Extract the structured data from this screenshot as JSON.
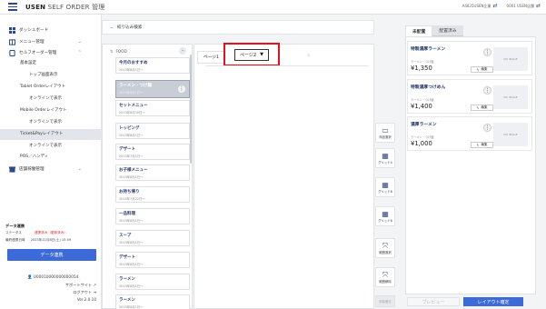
{
  "app": {
    "brand_bold": "USEN",
    "brand_rest": " SELF ORDER 管理"
  },
  "topbar": {
    "store1": "A4835USEN企業",
    "store2": "0001 USEN店舗"
  },
  "sidebar": {
    "items": [
      {
        "label": "ダッシュボード"
      },
      {
        "label": "メニュー管理"
      },
      {
        "label": "セルフオーダー管理"
      }
    ],
    "subitems": [
      {
        "label": "基本設定"
      },
      {
        "label": "トップ画面表示"
      },
      {
        "label": "Tablet Orderレイアウト"
      },
      {
        "label": "オンラインで表示"
      },
      {
        "label": "Mobile Orderレイアウト"
      },
      {
        "label": "オンラインで表示"
      },
      {
        "label": "Ticket&Payレイアウト"
      },
      {
        "label": "オンラインで表示"
      },
      {
        "label": "POS／ハンディ"
      }
    ],
    "store_item": "店舗稼働管理",
    "data_link_title": "データ連携",
    "data_link_status_label": "ステータス",
    "data_link_status_value": "連携済み（更新済み）",
    "data_link_last_label": "最終連携日時",
    "data_link_last_value": "2023年11月8日(土) 15:59",
    "data_link_button": "データ連携",
    "user_id": "U00010000000000054",
    "support": "サポートサイト",
    "logout": "ログアウト",
    "version": "Ver.2.0.10"
  },
  "search": {
    "label": "絞り込み検索"
  },
  "category_head": "FOOD",
  "categories": [
    {
      "title": "今月のおすすめ",
      "date": "2023年8月1日〜"
    },
    {
      "title": "ラーメン・つけ麺",
      "date": "2023年8月1日〜"
    },
    {
      "title": "セットメニュー",
      "date": "2023年6月30日〜"
    },
    {
      "title": "トッピング",
      "date": "2023年8月1日〜"
    },
    {
      "title": "デザート",
      "date": "2023年7月1日〜"
    },
    {
      "title": "お子様メニュー",
      "date": "2023年8月1日〜"
    },
    {
      "title": "お持ち帰り",
      "date": "2023年7月22日〜"
    },
    {
      "title": "一品料理",
      "date": "2023年8月1日〜"
    },
    {
      "title": "スープ",
      "date": "2023年8月1日〜"
    },
    {
      "title": "デザート",
      "date": "2023年8月1日〜"
    },
    {
      "title": "ラーメン",
      "date": "2023年8月1日〜"
    },
    {
      "title": "ラーメン",
      "date": "2023年8月1日〜"
    }
  ],
  "page_tabs": {
    "tab1": "ページ1",
    "tab2": "ページ2",
    "dropdown_icon": "▼"
  },
  "tools": [
    {
      "label": "商品選択",
      "icon": "▭"
    },
    {
      "label": "グリッド4",
      "icon": "▦"
    },
    {
      "label": "グリッド8",
      "icon": "▦"
    },
    {
      "label": "グリッド6",
      "icon": "▦"
    },
    {
      "label": "範囲選択",
      "icon": "⤧"
    },
    {
      "label": "範囲解除",
      "icon": "⤧"
    },
    {
      "label": "削除確定",
      "icon": ""
    }
  ],
  "right_tabs": {
    "active": "未配置",
    "inactive": "配置済み"
  },
  "cards": [
    {
      "name": "特製濃厚ラーメン",
      "sub": "ラーメン・つけ麺",
      "price": "¥1,350",
      "edit": "編集",
      "noimg": "NO IMAGE"
    },
    {
      "name": "特製濃厚つけめん",
      "sub": "ラーメン・つけ麺",
      "price": "¥1,400",
      "edit": "編集",
      "noimg": "NO IMAGE"
    },
    {
      "name": "濃厚ラーメン",
      "sub": "ラーメン・つけ麺",
      "price": "¥1,000",
      "edit": "編集",
      "noimg": "NO IMAGE"
    }
  ],
  "footer": {
    "preview": "プレビュー",
    "confirm": "レイアウト確定"
  }
}
